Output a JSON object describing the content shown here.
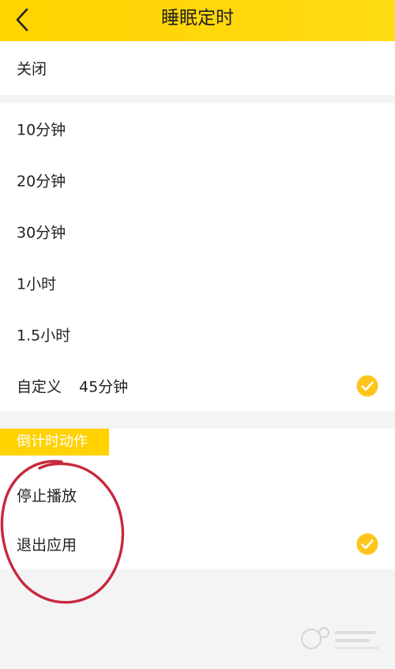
{
  "header": {
    "title": "睡眠定时",
    "back_icon": "chevron-left-icon",
    "background": "#ffd400"
  },
  "timer_options": [
    {
      "label": "关闭",
      "value": "",
      "selected": false
    },
    {
      "label": "10分钟",
      "value": "",
      "selected": false
    },
    {
      "label": "20分钟",
      "value": "",
      "selected": false
    },
    {
      "label": "30分钟",
      "value": "",
      "selected": false
    },
    {
      "label": "1小时",
      "value": "",
      "selected": false
    },
    {
      "label": "1.5小时",
      "value": "",
      "selected": false
    },
    {
      "label": "自定义",
      "value": "45分钟",
      "selected": true
    }
  ],
  "countdown_action": {
    "section_label": "倒计时动作",
    "options": [
      {
        "label": "停止播放",
        "selected": false
      },
      {
        "label": "退出应用",
        "selected": true
      }
    ]
  },
  "colors": {
    "accent": "#ffd200",
    "check": "#ffc51c",
    "annotation": "#c8283c",
    "page_bg": "#f4f4f4"
  },
  "icons": {
    "check": "check-circle-icon",
    "annotation": "red-hand-drawn-circle",
    "watermark": "watermark-logo"
  }
}
